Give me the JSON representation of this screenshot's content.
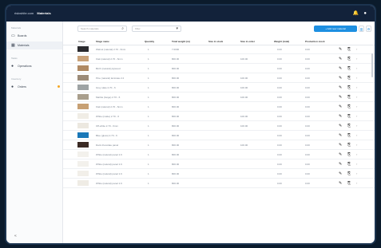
{
  "topbar": {
    "brand": "riskwhite.com",
    "title": "Materials",
    "icons": [
      "bell-icon",
      "user-icon"
    ]
  },
  "sidebar": {
    "sections": [
      {
        "label": "Materials"
      },
      {
        "label": "Tasks"
      },
      {
        "label": "Inventory"
      }
    ],
    "items": [
      {
        "label": "Boards",
        "icon": "board-icon"
      },
      {
        "label": "Materials",
        "icon": "layers-icon"
      },
      {
        "label": "Operations",
        "icon": "gear-icon"
      },
      {
        "label": "Orders",
        "icon": "box-icon"
      }
    ],
    "collapse_icon": "collapse-icon"
  },
  "toolbar": {
    "search_placeholder": "Search materials",
    "filter_placeholder": "Filter",
    "add_label": "+ Add new material",
    "icon_buttons": [
      "columns-icon",
      "settings-icon"
    ]
  },
  "table": {
    "headers": [
      "Image",
      "Stage name",
      "Quantity",
      "Total weight (m)",
      "Size in stock",
      "Size in order",
      "Weight (total)",
      "Production stock"
    ],
    "rows": [
      {
        "name": "Walnut (natural) 2.70 - 6mm",
        "qty": "1",
        "w": "7.0000",
        "s1": "",
        "s2": "",
        "wt": "0.00",
        "p": "0.00",
        "color": "#2a2a2e"
      },
      {
        "name": "Oak (natural) 2.70 - 6mm",
        "qty": "1",
        "w": "800.00",
        "s1": "",
        "s2": "100.00",
        "wt": "0.00",
        "p": "0.00",
        "color": "#c9a27a"
      },
      {
        "name": "Birch (natural) plywood",
        "qty": "1",
        "w": "800.00",
        "s1": "",
        "s2": "",
        "wt": "0.00",
        "p": "0.00",
        "color": "#b08a64"
      },
      {
        "name": "Pine (natural) laminate 2.2",
        "qty": "1",
        "w": "800.00",
        "s1": "",
        "s2": "100.00",
        "wt": "0.00",
        "p": "0.00",
        "color": "#9c8b78"
      },
      {
        "name": "Grey slate 2.70 - 6",
        "qty": "1",
        "w": "800.00",
        "s1": "",
        "s2": "100.00",
        "wt": "0.00",
        "p": "0.00",
        "color": "#9ea3a4"
      },
      {
        "name": "Marble (beige) 2.70 - 6",
        "qty": "1",
        "w": "800.00",
        "s1": "",
        "s2": "100.00",
        "wt": "0.00",
        "p": "0.00",
        "color": "#a99e8c"
      },
      {
        "name": "Oak (natural) 2.70 - 6mm",
        "qty": "1",
        "w": "800.00",
        "s1": "",
        "s2": "",
        "wt": "0.00",
        "p": "0.00",
        "color": "#c7a074"
      },
      {
        "name": "White (matte) 2.70 - 6",
        "qty": "1",
        "w": "800.00",
        "s1": "",
        "s2": "100.00",
        "wt": "0.00",
        "p": "0.00",
        "color": "#f0ede6"
      },
      {
        "name": "Off-white 2.70 - 6mm",
        "qty": "1",
        "w": "800.00",
        "s1": "",
        "s2": "100.00",
        "wt": "0.00",
        "p": "0.00",
        "color": "#ece8e0"
      },
      {
        "name": "Blue (gloss) 2.70 - 6",
        "qty": "1",
        "w": "800.00",
        "s1": "",
        "s2": "",
        "wt": "0.00",
        "p": "0.00",
        "color": "#1a78b8"
      },
      {
        "name": "Dark chocolate panel",
        "qty": "1",
        "w": "800.00",
        "s1": "",
        "s2": "100.00",
        "wt": "0.00",
        "p": "0.00",
        "color": "#3a2a24"
      },
      {
        "name": "White (natural) panel 1.6",
        "qty": "1",
        "w": "800.00",
        "s1": "",
        "s2": "",
        "wt": "0.00",
        "p": "0.00",
        "color": "#f3f1ec"
      },
      {
        "name": "White (natural) panel 1.6",
        "qty": "1",
        "w": "800.00",
        "s1": "",
        "s2": "",
        "wt": "0.00",
        "p": "0.00",
        "color": "#f3f1ec"
      },
      {
        "name": "White (natural) panel 1.6",
        "qty": "1",
        "w": "800.00",
        "s1": "",
        "s2": "",
        "wt": "0.00",
        "p": "0.00",
        "color": "#f2efe9"
      },
      {
        "name": "White (natural) panel 1.6",
        "qty": "1",
        "w": "800.00",
        "s1": "",
        "s2": "",
        "wt": "0.00",
        "p": "0.00",
        "color": "#efece5"
      }
    ],
    "row_actions": [
      "pencil-icon",
      "copy-icon",
      "more-icon"
    ]
  },
  "colors": {
    "topbar": "#12223a",
    "accent": "#1d8fe1",
    "warning": "#f5a623"
  }
}
